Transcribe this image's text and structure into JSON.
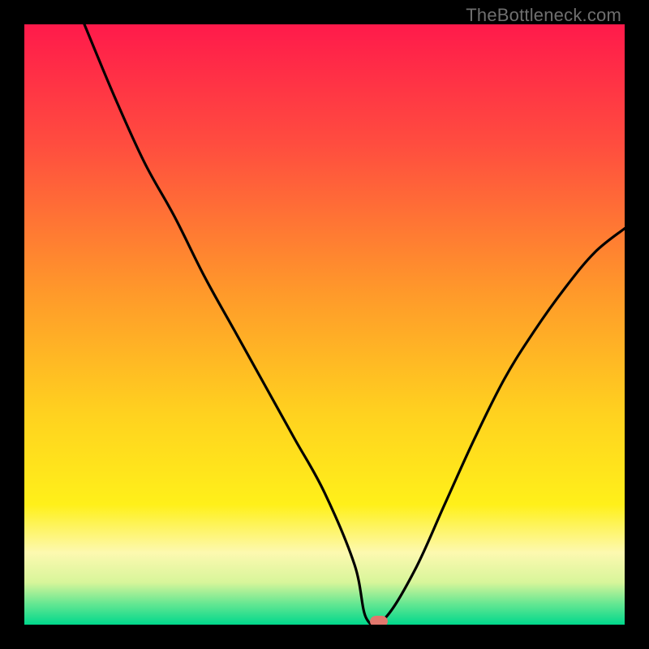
{
  "watermark": "TheBottleneck.com",
  "chart_data": {
    "type": "line",
    "title": "",
    "xlabel": "",
    "ylabel": "",
    "xlim": [
      0,
      100
    ],
    "ylim": [
      0,
      100
    ],
    "series": [
      {
        "name": "bottleneck-curve",
        "x": [
          10,
          15,
          20,
          25,
          30,
          35,
          40,
          45,
          50,
          55,
          57,
          60,
          65,
          70,
          75,
          80,
          85,
          90,
          95,
          100
        ],
        "y": [
          100,
          88,
          77,
          68,
          58,
          49,
          40,
          31,
          22,
          10,
          1,
          1,
          9,
          20,
          31,
          41,
          49,
          56,
          62,
          66
        ]
      }
    ],
    "marker": {
      "x": 59,
      "y": 0.6,
      "color": "#e1776d"
    },
    "gradient_stops": [
      {
        "pos": 0.0,
        "color": "#ff1a4b"
      },
      {
        "pos": 0.2,
        "color": "#ff4d3f"
      },
      {
        "pos": 0.45,
        "color": "#ff9a2a"
      },
      {
        "pos": 0.65,
        "color": "#ffd21f"
      },
      {
        "pos": 0.8,
        "color": "#fff01a"
      },
      {
        "pos": 0.88,
        "color": "#fdf9b0"
      },
      {
        "pos": 0.93,
        "color": "#d7f59a"
      },
      {
        "pos": 0.965,
        "color": "#66e792"
      },
      {
        "pos": 1.0,
        "color": "#00d88c"
      }
    ]
  }
}
